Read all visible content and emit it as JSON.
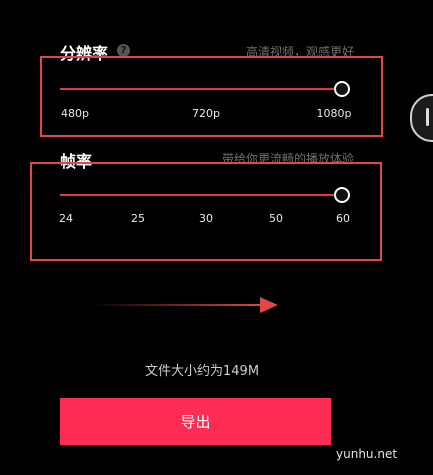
{
  "resolution": {
    "title": "分辨率",
    "help_icon": "?",
    "hint": "高清视频，观感更好",
    "ticks": [
      "480p",
      "720p",
      "1080p"
    ],
    "selected": "1080p"
  },
  "frame_rate": {
    "title": "帧率",
    "hint": "带给你更流畅的播放体验",
    "ticks": [
      "24",
      "25",
      "30",
      "50",
      "60"
    ],
    "selected": "60"
  },
  "file_size_text": "文件大小约为149M",
  "export_label": "导出",
  "watermark": "yunhu.net",
  "colors": {
    "accent": "#fe2c55",
    "annotation": "#e04848",
    "background": "#000000"
  }
}
